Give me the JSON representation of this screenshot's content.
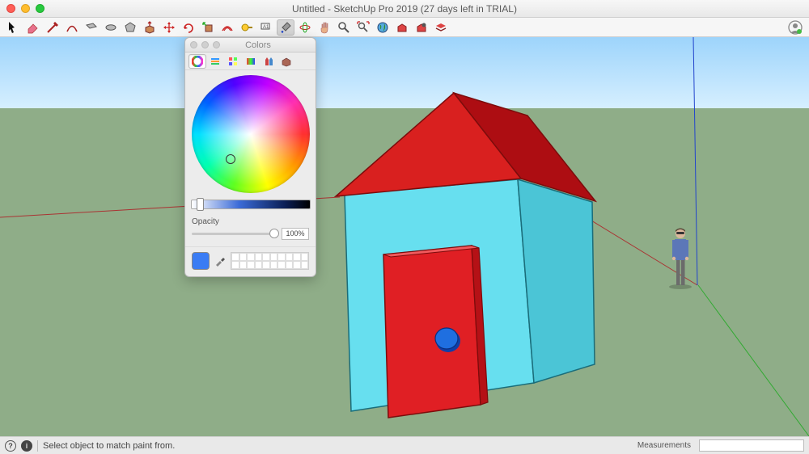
{
  "window": {
    "title": "Untitled - SketchUp Pro 2019 (27 days left in TRIAL)"
  },
  "toolbar": {
    "tools": [
      {
        "name": "select-tool",
        "icon": "arrow"
      },
      {
        "name": "eraser-tool",
        "icon": "eraser"
      },
      {
        "name": "line-tool",
        "icon": "pencil"
      },
      {
        "name": "arc-tool",
        "icon": "arc"
      },
      {
        "name": "rectangle-tool",
        "icon": "rect"
      },
      {
        "name": "circle-tool",
        "icon": "circle"
      },
      {
        "name": "polygon-tool",
        "icon": "polygon"
      },
      {
        "name": "pushpull-tool",
        "icon": "pushpull"
      },
      {
        "name": "move-tool",
        "icon": "move"
      },
      {
        "name": "rotate-tool",
        "icon": "rotate"
      },
      {
        "name": "scale-tool",
        "icon": "scale"
      },
      {
        "name": "offset-tool",
        "icon": "offset"
      },
      {
        "name": "tape-tool",
        "icon": "tape"
      },
      {
        "name": "text-tool",
        "icon": "text"
      },
      {
        "name": "paint-tool",
        "icon": "paint",
        "active": true
      },
      {
        "name": "orbit-tool",
        "icon": "orbit"
      },
      {
        "name": "pan-tool",
        "icon": "pan"
      },
      {
        "name": "zoom-tool",
        "icon": "zoom"
      },
      {
        "name": "zoom-extents-tool",
        "icon": "zoomx"
      },
      {
        "name": "add-location-tool",
        "icon": "globe"
      },
      {
        "name": "warehouse-tool",
        "icon": "box"
      },
      {
        "name": "extension-warehouse-tool",
        "icon": "extbox"
      },
      {
        "name": "layers-tool",
        "icon": "layers"
      }
    ]
  },
  "color_panel": {
    "title": "Colors",
    "opacity_label": "Opacity",
    "opacity_value": "100%",
    "current_color": "#3a7cf4",
    "tabs": [
      "wheel",
      "sliders",
      "palette",
      "spectrum",
      "crayons",
      "materials"
    ]
  },
  "scene": {
    "sky": "#bfe5ff",
    "ground": "#8fad88",
    "house_wall": "#67dfef",
    "house_wall_shadow": "#4bc5d6",
    "roof": "#d9201f",
    "roof_shadow": "#ad0d12",
    "door": "#e01f24",
    "door_side": "#b51116",
    "knob": "#1f6fe0",
    "figure_shirt": "#5c77b8",
    "figure_skin": "#dcb89c"
  },
  "status": {
    "hint": "Select object to match paint from.",
    "measurements_label": "Measurements",
    "measurements_value": ""
  }
}
